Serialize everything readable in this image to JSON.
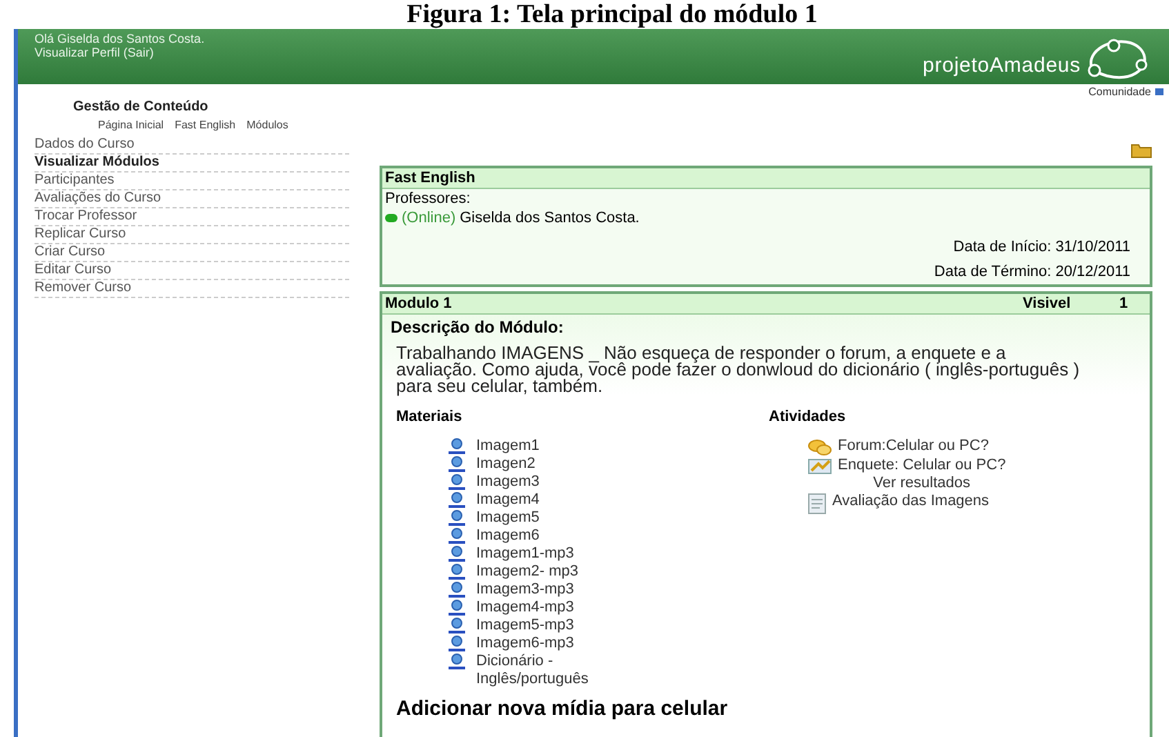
{
  "caption": "Figura 1: Tela principal do módulo 1",
  "header": {
    "greeting": "Olá Giselda dos Santos Costa.",
    "profile_link": "Visualizar Perfil (Sair)",
    "logo": "projetoAmadeus"
  },
  "community_link": "Comunidade",
  "section_title": "Gestão de Conteúdo",
  "breadcrumbs": [
    "Página Inicial",
    "Fast English",
    "Módulos"
  ],
  "sidebar": {
    "items": [
      {
        "label": "Dados do Curso",
        "selected": false
      },
      {
        "label": "Visualizar Módulos",
        "selected": true
      },
      {
        "label": "Participantes",
        "selected": false
      },
      {
        "label": "Avaliações do Curso",
        "selected": false
      },
      {
        "label": "Trocar Professor",
        "selected": false
      },
      {
        "label": "Replicar Curso",
        "selected": false
      },
      {
        "label": "Criar Curso",
        "selected": false
      },
      {
        "label": "Editar Curso",
        "selected": false
      },
      {
        "label": "Remover Curso",
        "selected": false
      }
    ]
  },
  "course": {
    "title": "Fast English",
    "teachers_label": "Professores:",
    "teacher": {
      "status": "(Online)",
      "name": "Giselda dos Santos Costa.",
      "online": true
    },
    "start": "Data de Início: 31/10/2011",
    "end": "Data de Término: 20/12/2011"
  },
  "module": {
    "title": "Modulo 1",
    "visibility": "Visivel",
    "number": "1",
    "description_label": "Descrição do Módulo:",
    "description": "Trabalhando  IMAGENS _ Não esqueça de responder o forum, a enquete e a avaliação. Como ajuda, você pode fazer o donwloud do dicionário ( inglês-português ) para seu celular, também.",
    "materials_label": "Materiais",
    "materials": [
      "Imagem1",
      "Imagen2",
      "Imagem3",
      "Imagem4",
      "Imagem5",
      "Imagem6",
      "Imagem1-mp3",
      "Imagem2- mp3",
      "Imagem3-mp3",
      "Imagem4-mp3",
      "Imagem5-mp3",
      "Imagem6-mp3",
      "Dicionário - Inglês/português"
    ],
    "activities_label": "Atividades",
    "activities": [
      {
        "kind": "forum",
        "label": "Forum:Celular ou PC?"
      },
      {
        "kind": "poll",
        "label": "Enquete: Celular ou PC?",
        "link": "Ver resultados"
      },
      {
        "kind": "evaluation",
        "label": "Avaliação das Imagens"
      }
    ],
    "add_media": "Adicionar nova mídia para celular"
  }
}
